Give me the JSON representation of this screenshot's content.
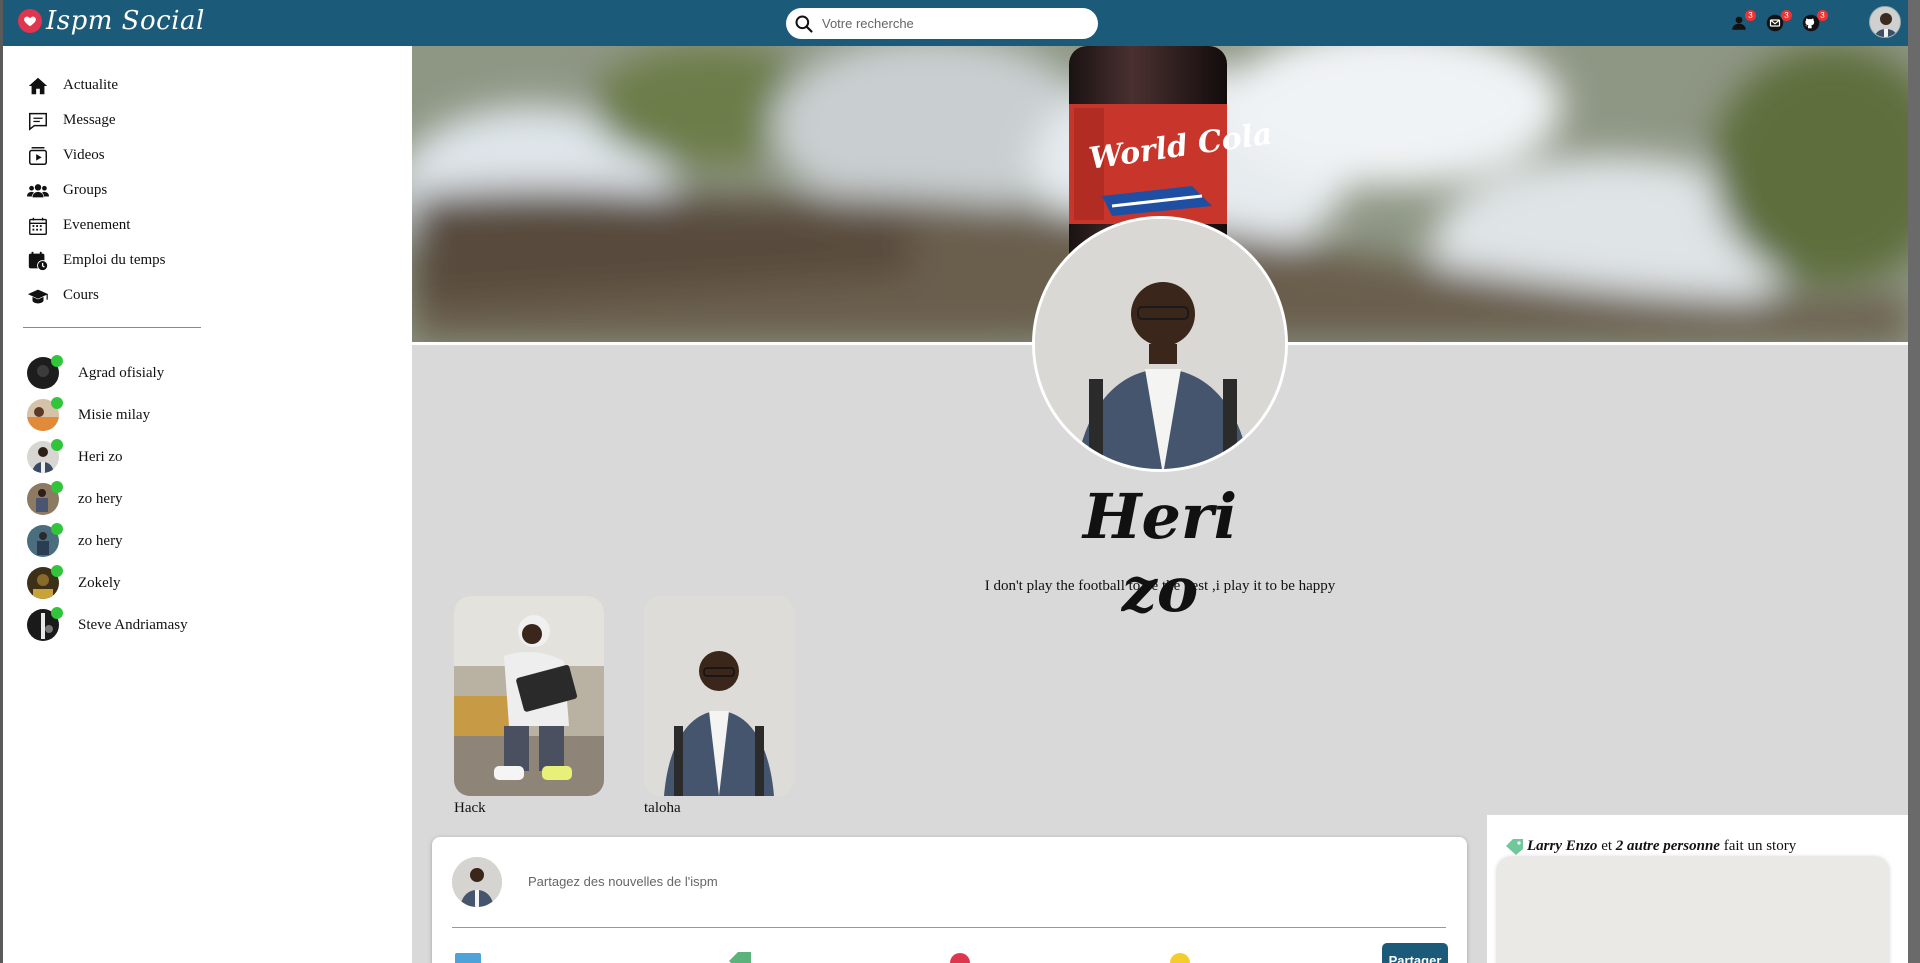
{
  "app": {
    "name": "Ispm Social"
  },
  "search": {
    "placeholder": "Votre recherche"
  },
  "topbar": {
    "friends_badge": "3",
    "messages_badge": "3",
    "github_badge": "3"
  },
  "sidebar": {
    "menu": [
      {
        "label": "Actualite",
        "icon": "home-icon"
      },
      {
        "label": "Message",
        "icon": "message-icon"
      },
      {
        "label": "Videos",
        "icon": "video-icon"
      },
      {
        "label": "Groups",
        "icon": "groups-icon"
      },
      {
        "label": "Evenement",
        "icon": "calendar-icon"
      },
      {
        "label": "Emploi du temps",
        "icon": "schedule-icon"
      },
      {
        "label": "Cours",
        "icon": "graduation-cap-icon"
      }
    ],
    "contacts": [
      {
        "name": "Agrad ofisialy",
        "online": true
      },
      {
        "name": "Misie milay",
        "online": true
      },
      {
        "name": "Heri zo",
        "online": true
      },
      {
        "name": "zo hery",
        "online": true
      },
      {
        "name": "zo hery",
        "online": true
      },
      {
        "name": "Zokely",
        "online": true
      },
      {
        "name": "Steve Andriamasy",
        "online": true
      }
    ]
  },
  "profile": {
    "name": "Heri zo",
    "bio": "I don't play the football to be the best ,i play it to be happy",
    "cover_text": "World Cola"
  },
  "highlights": [
    {
      "label": "Hack"
    },
    {
      "label": "taloha"
    }
  ],
  "composer": {
    "placeholder": "Partagez des nouvelles de l'ispm",
    "share_label": "Partager"
  },
  "story": {
    "person": "Larry Enzo",
    "connector": " et ",
    "others": "2 autre personne",
    "suffix": " fait un story"
  },
  "colors": {
    "topbar": "#1b5a79",
    "online": "#32c53c",
    "badge": "#ee3333"
  }
}
